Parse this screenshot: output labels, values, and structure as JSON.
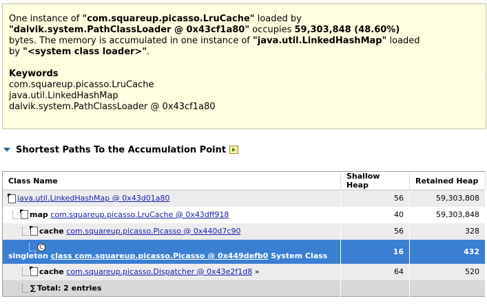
{
  "summary": {
    "t1": "One instance of ",
    "class_name": "\"com.squareup.picasso.LruCache\"",
    "t2": " loaded by",
    "loader": "\"dalvik.system.PathClassLoader @ 0x43cf1a80\"",
    "t3": " occupies ",
    "size": "59,303,848 (48.60%)",
    "t4": "bytes. The memory is accumulated in one instance of ",
    "acc_class": "\"java.util.LinkedHashMap\"",
    "t5": " loaded",
    "t6": "by ",
    "acc_loader": "\"<system class loader>\"",
    "t7": ".",
    "keywords_title": "Keywords",
    "keywords": [
      "com.squareup.picasso.LruCache",
      "java.util.LinkedHashMap",
      "dalvik.system.PathClassLoader @ 0x43cf1a80"
    ]
  },
  "section": {
    "title": "Shortest Paths To the Accumulation Point",
    "icon": "query-browser-icon"
  },
  "table": {
    "headers": [
      "Class Name",
      "Shallow Heap",
      "Retained Heap"
    ],
    "rows": [
      {
        "field": "",
        "link": "java.util.LinkedHashMap @ 0x43d01a80",
        "suffix": "",
        "shallow": "56",
        "retained": "59,303,808"
      },
      {
        "field": "map",
        "link": "com.squareup.picasso.LruCache @ 0x43dff918",
        "suffix": "",
        "shallow": "40",
        "retained": "59,303,848"
      },
      {
        "field": "cache",
        "link": "com.squareup.picasso.Picasso @ 0x440d7c90",
        "suffix": "",
        "shallow": "56",
        "retained": "328"
      },
      {
        "field": "singleton",
        "link": "class com.squareup.picasso.Picasso @ 0x449defb0",
        "suffix": " System Class",
        "shallow": "16",
        "retained": "432"
      },
      {
        "field": "cache",
        "link": "com.squareup.picasso.Dispatcher @ 0x43e2f1d8",
        "suffix": " »",
        "shallow": "64",
        "retained": "520"
      },
      {
        "field": "",
        "link": "",
        "suffix": "Total: 2 entries",
        "shallow": "",
        "retained": ""
      }
    ]
  },
  "colors": {
    "selection": "#3a7fd2",
    "summary_bg": "#ffffe1",
    "link": "#1a1aa8"
  }
}
